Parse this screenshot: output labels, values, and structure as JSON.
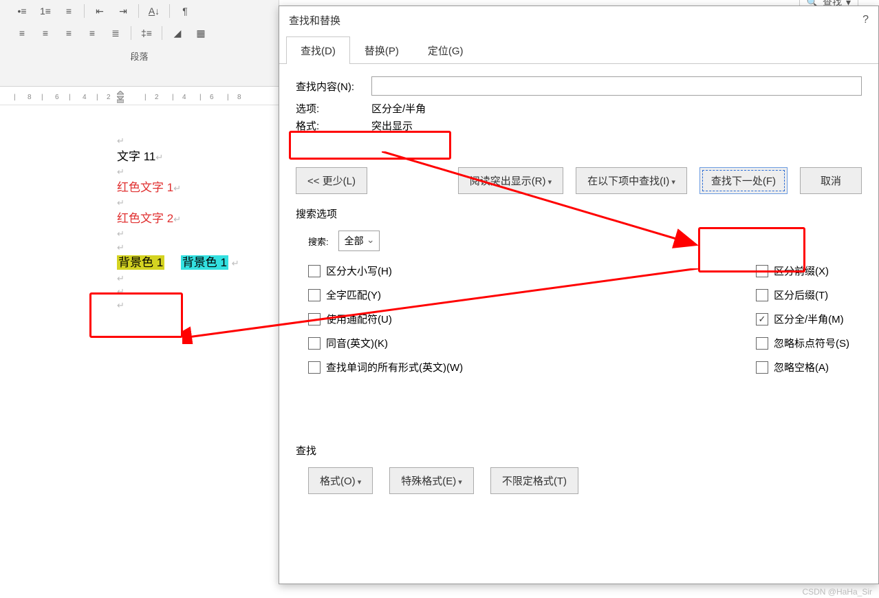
{
  "ribbon": {
    "section_label": "段落"
  },
  "ruler": {
    "ticks_left": [
      "8",
      "6",
      "4",
      "2"
    ],
    "ticks_right": [
      "2",
      "4",
      "6",
      "8"
    ]
  },
  "document": {
    "line1": "文字 11",
    "red1": "红色文字 1",
    "red2": "红色文字 2",
    "bg1": "背景色 1",
    "bg2": "背景色 1"
  },
  "search_top": "查找",
  "dialog": {
    "title": "查找和替换",
    "help": "?",
    "tabs": {
      "find": "查找(D)",
      "replace": "替换(P)",
      "goto": "定位(G)"
    },
    "find_label": "查找内容(N):",
    "find_value": "",
    "option_label": "选项:",
    "option_value": "区分全/半角",
    "format_label": "格式:",
    "format_value": "突出显示",
    "buttons": {
      "less": "<< 更少(L)",
      "reading": "阅读突出显示(R)",
      "findin": "在以下项中查找(I)",
      "findnext": "查找下一处(F)",
      "cancel": "取消"
    },
    "search_opts_label": "搜索选项",
    "search_label": "搜索:",
    "search_value": "全部",
    "left_opts": {
      "case": "区分大小写(H)",
      "whole": "全字匹配(Y)",
      "wildcard": "使用通配符(U)",
      "sounds": "同音(英文)(K)",
      "forms": "查找单词的所有形式(英文)(W)"
    },
    "right_opts": {
      "prefix": "区分前缀(X)",
      "suffix": "区分后缀(T)",
      "fullhalf": "区分全/半角(M)",
      "punct": "忽略标点符号(S)",
      "space": "忽略空格(A)"
    },
    "find_section": "查找",
    "footer_btns": {
      "format": "格式(O)",
      "special": "特殊格式(E)",
      "noformat": "不限定格式(T)"
    }
  },
  "watermark": "CSDN @HaHa_Sir"
}
